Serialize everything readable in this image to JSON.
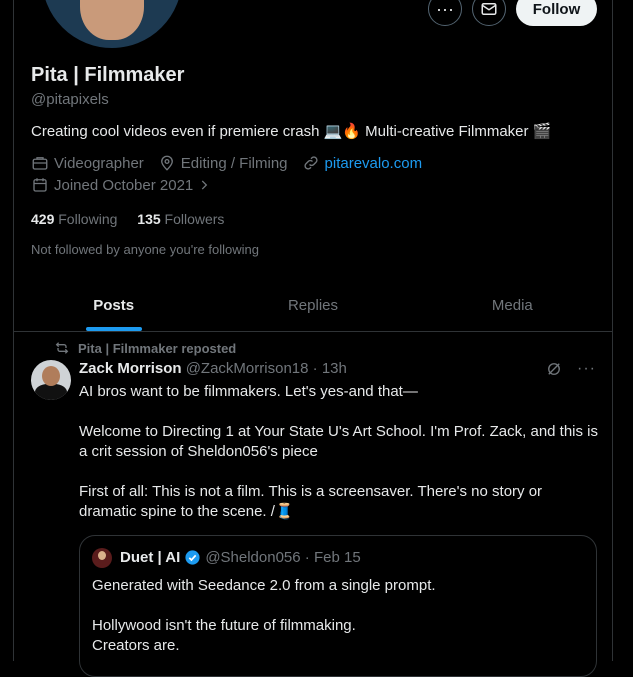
{
  "profile": {
    "name": "Pita | Filmmaker",
    "handle": "@pitapixels",
    "bio": "Creating cool videos even if premiere crash 💻🔥 Multi-creative Filmmaker 🎬",
    "profession": "Videographer",
    "location": "Editing / Filming",
    "website": "pitarevalo.com",
    "joined": "Joined October 2021",
    "following_count": "429",
    "following_label": "Following",
    "followers_count": "135",
    "followers_label": "Followers",
    "not_followed": "Not followed by anyone you're following"
  },
  "actions": {
    "more_label": "···",
    "message_icon": "mail-icon",
    "follow_label": "Follow"
  },
  "tabs": [
    {
      "label": "Posts",
      "active": true
    },
    {
      "label": "Replies",
      "active": false
    },
    {
      "label": "Media",
      "active": false
    }
  ],
  "tweet": {
    "repost_label": "Pita | Filmmaker reposted",
    "author_name": "Zack Morrison",
    "author_handle": "@ZackMorrison18",
    "time": "13h",
    "text": "AI bros want to be filmmakers. Let's yes-and that—\n\nWelcome to Directing 1 at Your State U's Art School. I'm Prof. Zack, and this is a crit session of Sheldon056's piece\n\nFirst of all: This is not a film. This is a screensaver. There's no story or dramatic spine to the scene. /🧵",
    "quote": {
      "author_name": "Duet | AI",
      "author_handle": "@Sheldon056",
      "time": "Feb 15",
      "text": "Generated with Seedance 2.0 from a single prompt.\n\nHollywood isn't the future of filmmaking.\nCreators are."
    }
  },
  "colors": {
    "accent": "#1d9bf0",
    "muted": "#71767b",
    "text": "#e7e9ea",
    "border": "#2f3336"
  }
}
